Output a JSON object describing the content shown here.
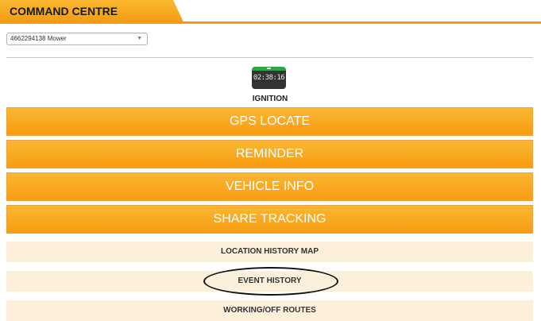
{
  "header": {
    "title": "COMMAND CENTRE"
  },
  "vehicle_select": {
    "value": "4662294138 Mower"
  },
  "ignition": {
    "time": "02:38:16",
    "label": "IGNITION"
  },
  "buttons": {
    "gps_locate": "GPS LOCATE",
    "reminder": "REMINDER",
    "vehicle_info": "VEHICLE INFO",
    "share_tracking": "SHARE TRACKING"
  },
  "links": {
    "location_history_map": "LOCATION HISTORY MAP",
    "event_history": "EVENT HISTORY",
    "working_off_routes": "WORKING/OFF ROUTES"
  }
}
